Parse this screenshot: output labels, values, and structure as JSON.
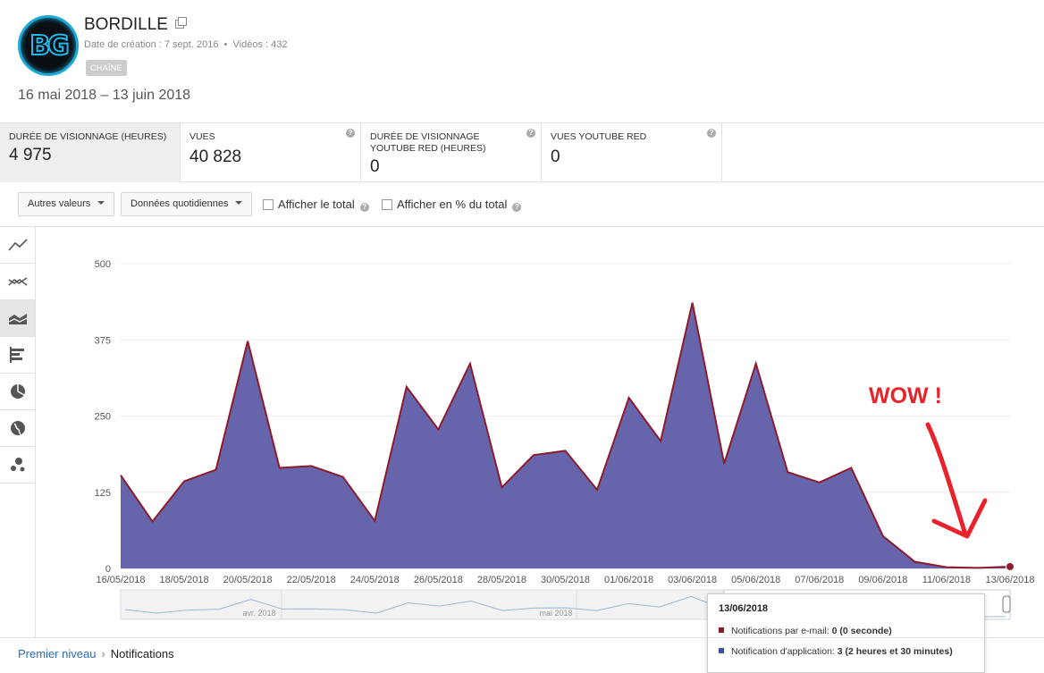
{
  "channel": {
    "name": "BORDILLE",
    "avatar_text": "BG",
    "created": "Date de création : 7 sept. 2016",
    "videos": "Vidéos : 432",
    "badge": "CHAÎNE"
  },
  "date_range": "16 mai 2018 – 13 juin 2018",
  "metrics": [
    {
      "label": "DURÉE DE VISIONNAGE (HEURES)",
      "value": "4 975",
      "active": true
    },
    {
      "label": "VUES",
      "value": "40 828"
    },
    {
      "label": "DURÉE DE VISIONNAGE YOUTUBE RED (HEURES)",
      "value": "0"
    },
    {
      "label": "VUES YOUTUBE RED",
      "value": "0"
    }
  ],
  "help_glyph": "?",
  "toolbar": {
    "other_values": "Autres valeurs",
    "daily_data": "Données quotidiennes",
    "show_total": "Afficher le total",
    "show_percent": "Afficher en % du total"
  },
  "sidebar_icons": [
    "line-chart-icon",
    "multiline-chart-icon",
    "stacked-area-icon",
    "bar-chart-icon",
    "pie-chart-icon",
    "map-icon",
    "bubble-chart-icon"
  ],
  "chart_data": {
    "type": "area",
    "x": [
      "16/05/2018",
      "17/05/2018",
      "18/05/2018",
      "19/05/2018",
      "20/05/2018",
      "21/05/2018",
      "22/05/2018",
      "23/05/2018",
      "24/05/2018",
      "25/05/2018",
      "26/05/2018",
      "27/05/2018",
      "28/05/2018",
      "29/05/2018",
      "30/05/2018",
      "31/05/2018",
      "01/06/2018",
      "02/06/2018",
      "03/06/2018",
      "04/06/2018",
      "05/06/2018",
      "06/06/2018",
      "07/06/2018",
      "08/06/2018",
      "09/06/2018",
      "10/06/2018",
      "11/06/2018",
      "12/06/2018",
      "13/06/2018"
    ],
    "x_tick_labels": [
      "16/05/2018",
      "18/05/2018",
      "20/05/2018",
      "22/05/2018",
      "24/05/2018",
      "26/05/2018",
      "28/05/2018",
      "30/05/2018",
      "01/06/2018",
      "03/06/2018",
      "05/06/2018",
      "07/06/2018",
      "09/06/2018",
      "11/06/2018",
      "13/06/2018"
    ],
    "series": [
      {
        "name": "Notifications d'application",
        "values": [
          153,
          77,
          143,
          162,
          373,
          165,
          168,
          150,
          78,
          298,
          228,
          336,
          133,
          186,
          193,
          129,
          280,
          209,
          436,
          172,
          336,
          158,
          141,
          165,
          53,
          11,
          2,
          1,
          3
        ],
        "color": "#6664ab"
      },
      {
        "name": "Notifications par e-mail",
        "values": [
          0,
          0,
          0,
          0,
          0,
          0,
          0,
          0,
          0,
          0,
          0,
          0,
          0,
          0,
          0,
          0,
          0,
          0,
          0,
          0,
          0,
          0,
          0,
          0,
          0,
          0,
          0,
          0,
          0
        ],
        "color": "#8c1c2c"
      }
    ],
    "y_ticks": [
      0,
      125,
      250,
      375,
      500
    ],
    "ylim": [
      0,
      500
    ],
    "grid": true,
    "navigator_labels": [
      "avr. 2018",
      "mai 2018"
    ]
  },
  "annotation": "WOW !",
  "tooltip": {
    "date": "13/06/2018",
    "email_label": "Notifications par e-mail: ",
    "email_value": "0 (0 seconde)",
    "app_label": "Notification d'application: ",
    "app_value": "3 (2 heures et 30 minutes)",
    "email_color": "#8c1c2c",
    "app_color": "#4a4aa0"
  },
  "breadcrumb": {
    "root": "Premier niveau",
    "separator": "›",
    "current": "Notifications"
  }
}
